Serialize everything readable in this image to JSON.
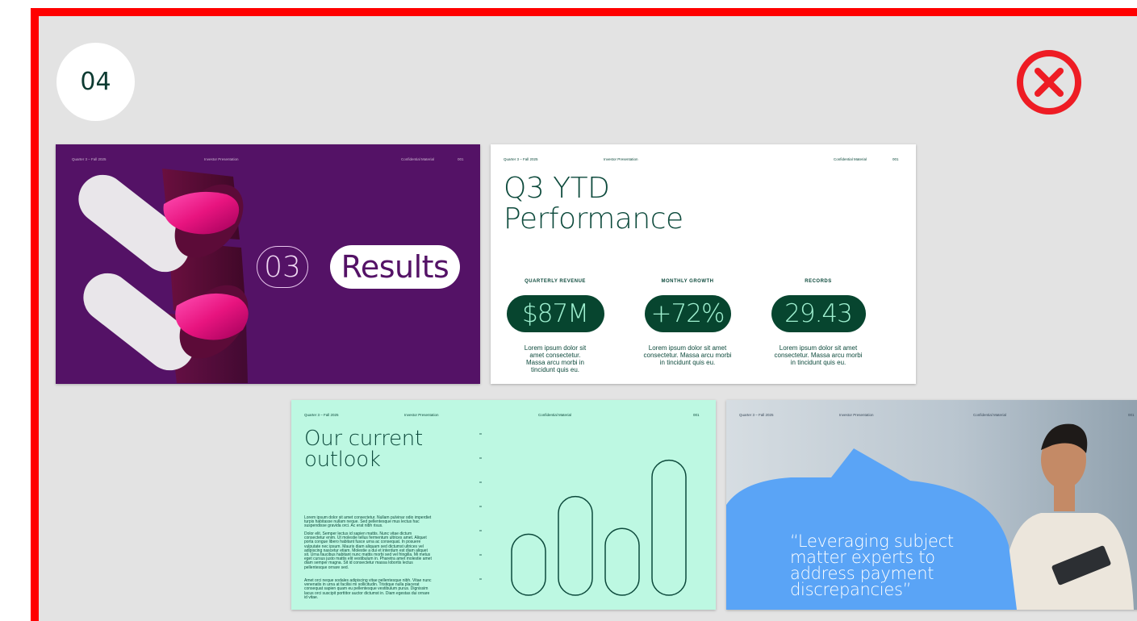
{
  "step_badge": "04",
  "close_icon": "close-circle-icon",
  "colors": {
    "frame_border": "#ff0000",
    "frame_bg": "#e3e3e3",
    "close": "#ee1c24"
  },
  "slides": [
    {
      "header": {
        "left": "Quarter 3 – Fall 2025",
        "center": "Investor Presentation",
        "right": "Confidential Material",
        "page": "001"
      },
      "section_number": "03",
      "section_title": "Results",
      "background": "#541266"
    },
    {
      "header": {
        "left": "Quarter 3 – Fall 2025",
        "center": "Investor Presentation",
        "right": "Confidential Material",
        "page": "001"
      },
      "title_line1": "Q3 YTD",
      "title_line2": "Performance",
      "metrics": [
        {
          "label": "QUARTERLY REVENUE",
          "value": "$87M",
          "desc": "Lorem ipsum dolor sit amet consectetur. Massa arcu morbi in tincidunt quis eu."
        },
        {
          "label": "MONTHLY GROWTH",
          "value": "+72%",
          "desc": "Lorem ipsum dolor sit amet consectetur. Massa arcu morbi in tincidunt quis eu."
        },
        {
          "label": "RECORDS",
          "value": "29.43",
          "desc": "Lorem ipsum dolor sit amet consectetur. Massa arcu morbi in tincidunt quis eu."
        }
      ]
    },
    {
      "header": {
        "left": "Quarter 3 – Fall 2025",
        "center": "Investor Presentation",
        "right": "Confidential Material",
        "page": "001"
      },
      "title_line1": "Our current",
      "title_line2": "outlook",
      "paragraphs": [
        "Lorem ipsum dolor sit amet consectetur. Nullam pulvinar odio imperdiet turpis habitasse nullam neque. Sed pellentesque mus lectus hac suspendisse gravida orci. Ac erat nibh risus.",
        "Dolor elit. Semper lectus id sapien mattis. Nunc vitae dictum consectetur enim. Ut molestie tellus fermentum ultrices amet. Aliquet porta congue libero habitant fusce urna ac consequat. In posuere vulputate nec ipsum. Mauris diam aliquam sed dictumst ultrices vel adipiscing nascetur etiam. Molestie a dui et interdum est diam aliquet sit. Urna faucibus habitant nunc mattis morbi sed vel fringilla. Mi metus eget cursus justo mattis elit vestibulum in. Pharetra amet molestie amet diam semper magna. Sit id consectetur massa lobortis lectus pellentesque ornare sed.",
        "Amet orci neque sodales adipiscing vitae pellentesque nibh. Vitae nunc venenatis in urna at facilisi mi sollicitudin. Tristique nulla placerat consequat sapien quam eu pellentesque vestibulum purus. Dignissim lacus orci suscipit porttitor auctor dictumst in. Diam egestas dui ornare id vitae."
      ],
      "bar_levels": [
        0.42,
        0.68,
        0.46,
        0.93
      ]
    },
    {
      "header": {
        "left": "Quarter 3 – Fall 2025",
        "center": "Investor Presentation",
        "right": "Confidential Material",
        "page": "001"
      },
      "quote": "“Leveraging subject matter experts to address payment discrepancies”",
      "accent": "#5aa4f6"
    }
  ]
}
